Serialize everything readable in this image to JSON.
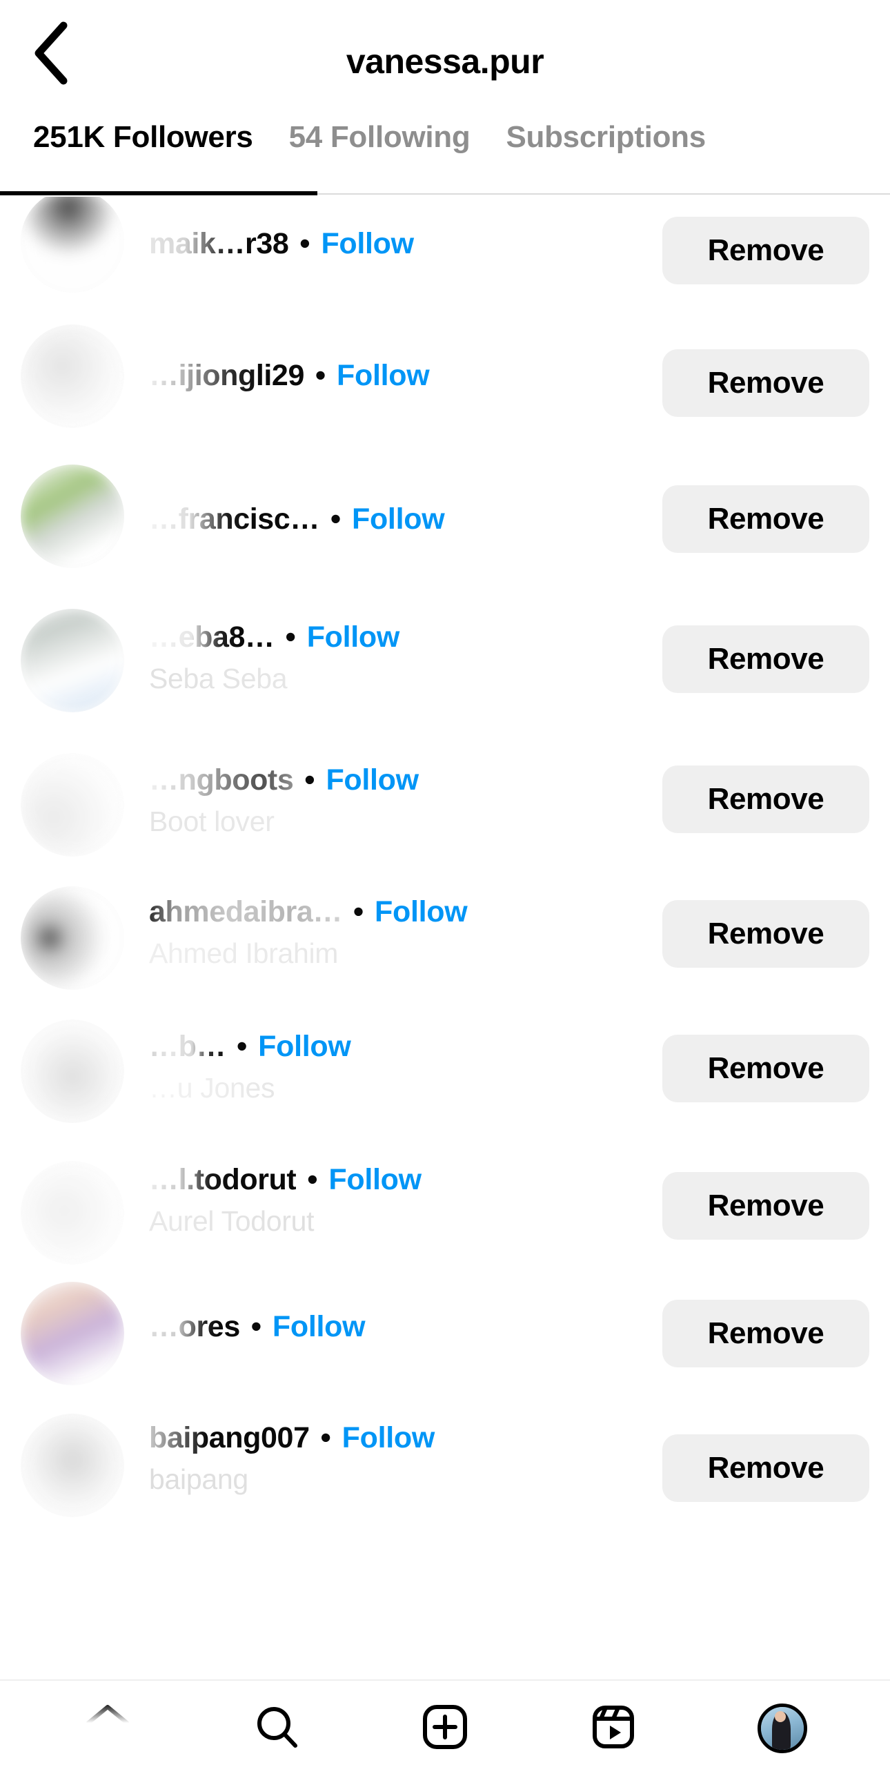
{
  "header": {
    "back_icon": "chevron-left-icon",
    "title": "vanessa.pur"
  },
  "tabs": [
    {
      "label": "251K Followers",
      "active": true
    },
    {
      "label": "54 Following",
      "active": false
    },
    {
      "label": "Subscriptions",
      "active": false
    }
  ],
  "list": {
    "follow_label": "Follow",
    "remove_label": "Remove",
    "separator": "•",
    "rows": [
      {
        "username": "maik…r38",
        "fullname": "",
        "follow": "Follow",
        "remove": "Remove"
      },
      {
        "username": "…ijiongli29",
        "fullname": "",
        "follow": "Follow",
        "remove": "Remove"
      },
      {
        "username": "…francisc…",
        "fullname": "",
        "follow": "Follow",
        "remove": "Remove"
      },
      {
        "username": "…eba8…",
        "fullname": "Seba Seba",
        "follow": "Follow",
        "remove": "Remove"
      },
      {
        "username": "…ngboots",
        "fullname": "Boot lover",
        "follow": "Follow",
        "remove": "Remove"
      },
      {
        "username": "ahmedaibra…",
        "fullname": "Ahmed Ibrahim",
        "follow": "Follow",
        "remove": "Remove"
      },
      {
        "username": "…b…",
        "fullname": "…u Jones",
        "follow": "Follow",
        "remove": "Remove"
      },
      {
        "username": "…l.todorut",
        "fullname": "Aurel Todorut",
        "follow": "Follow",
        "remove": "Remove"
      },
      {
        "username": "…ores",
        "fullname": "",
        "follow": "Follow",
        "remove": "Remove"
      },
      {
        "username": "baipang007",
        "fullname": "baipang",
        "follow": "Follow",
        "remove": "Remove"
      }
    ]
  },
  "bottom_nav": [
    {
      "icon": "home-icon"
    },
    {
      "icon": "search-icon"
    },
    {
      "icon": "create-post-icon"
    },
    {
      "icon": "reels-icon"
    },
    {
      "icon": "profile-avatar-icon"
    }
  ],
  "colors": {
    "follow_blue": "#0095f6",
    "remove_bg": "#efefef",
    "muted_text": "#8e8e8e",
    "active_text": "#000000"
  }
}
